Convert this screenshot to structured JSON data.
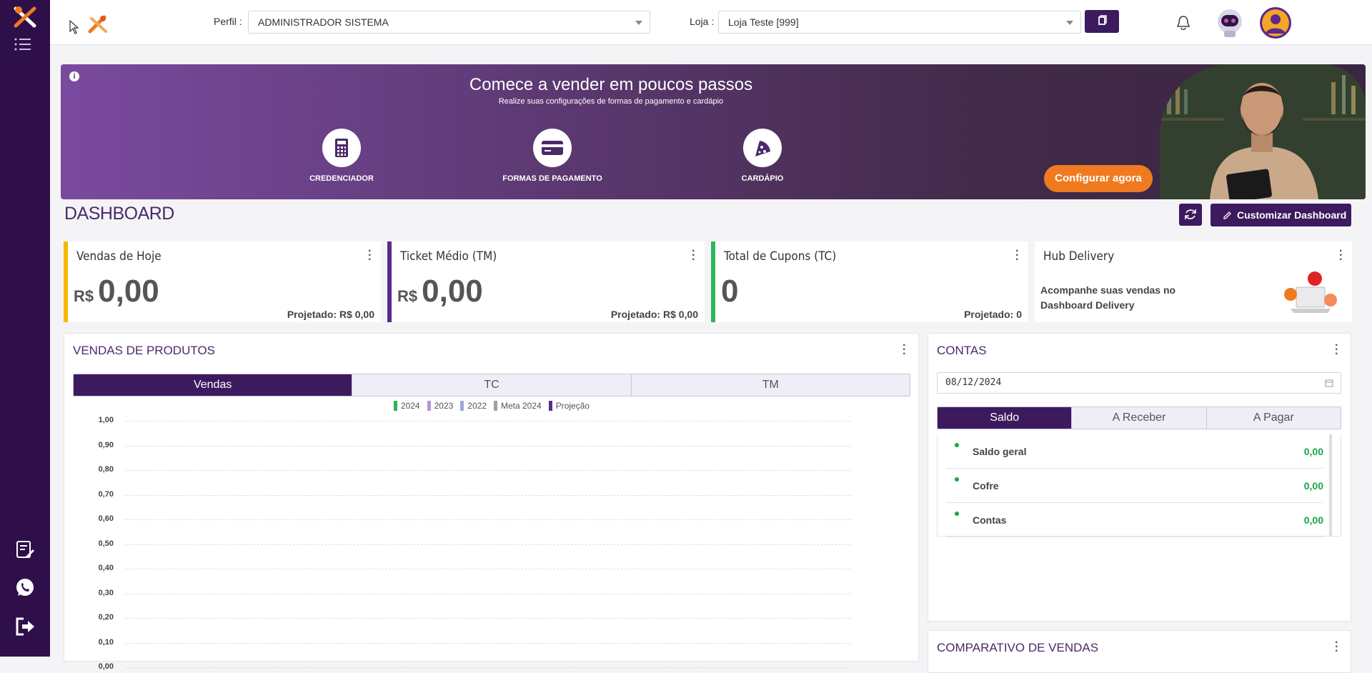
{
  "topbar": {
    "perfil_label": "Perfil :",
    "perfil_value": "ADMINISTRADOR SISTEMA",
    "loja_label": "Loja :",
    "loja_value": "Loja Teste [999]"
  },
  "banner": {
    "title": "Comece a vender em poucos passos",
    "subtitle": "Realize suas configurações de formas de pagamento e cardápio",
    "steps": [
      {
        "label": "CREDENCIADOR",
        "icon": "calculator-icon"
      },
      {
        "label": "FORMAS DE PAGAMENTO",
        "icon": "credit-card-icon"
      },
      {
        "label": "CARDÁPIO",
        "icon": "pizza-icon"
      }
    ],
    "cta": "Configurar agora"
  },
  "dashboard": {
    "title": "DASHBOARD",
    "customize_label": "Customizar Dashboard"
  },
  "cards": [
    {
      "title": "Vendas de Hoje",
      "currency": "R$",
      "value": "0,00",
      "projected": "Projetado: R$ 0,00",
      "color": "#f5b800"
    },
    {
      "title": "Ticket Médio (TM)",
      "currency": "R$",
      "value": "0,00",
      "projected": "Projetado: R$ 0,00",
      "color": "#5c2a8e"
    },
    {
      "title": "Total de Cupons (TC)",
      "currency": "",
      "value": "0",
      "projected": "Projetado: 0",
      "color": "#2db55d"
    },
    {
      "title": "Hub Delivery",
      "text": "Acompanhe suas vendas no Dashboard Delivery"
    }
  ],
  "vendas": {
    "title": "VENDAS DE PRODUTOS",
    "tabs": [
      "Vendas",
      "TC",
      "TM"
    ],
    "active_tab": "Vendas"
  },
  "chart_data": {
    "type": "bar",
    "series": [
      {
        "name": "2024",
        "values": [],
        "color": "#2db55d"
      },
      {
        "name": "2023",
        "values": [],
        "color": "#b197d0"
      },
      {
        "name": "2022",
        "values": [],
        "color": "#9ea8d8"
      },
      {
        "name": "Meta 2024",
        "values": [],
        "color": "#a0a0a0"
      },
      {
        "name": "Projeção",
        "values": [],
        "color": "#5c2a8e"
      }
    ],
    "ylim": [
      0,
      1
    ],
    "yticks": [
      "1,00",
      "0,90",
      "0,80",
      "0,70",
      "0,60",
      "0,50",
      "0,40",
      "0,30",
      "0,20",
      "0,10",
      "0,00"
    ],
    "grid": true,
    "legend_position": "top"
  },
  "contas": {
    "title": "CONTAS",
    "date": "08/12/2024",
    "tabs": [
      "Saldo",
      "A Receber",
      "A Pagar"
    ],
    "active_tab": "Saldo",
    "rows": [
      {
        "name": "Saldo geral",
        "value": "0,00"
      },
      {
        "name": "Cofre",
        "value": "0,00"
      },
      {
        "name": "Contas",
        "value": "0,00"
      }
    ]
  },
  "comparativo": {
    "title": "COMPARATIVO DE VENDAS"
  }
}
